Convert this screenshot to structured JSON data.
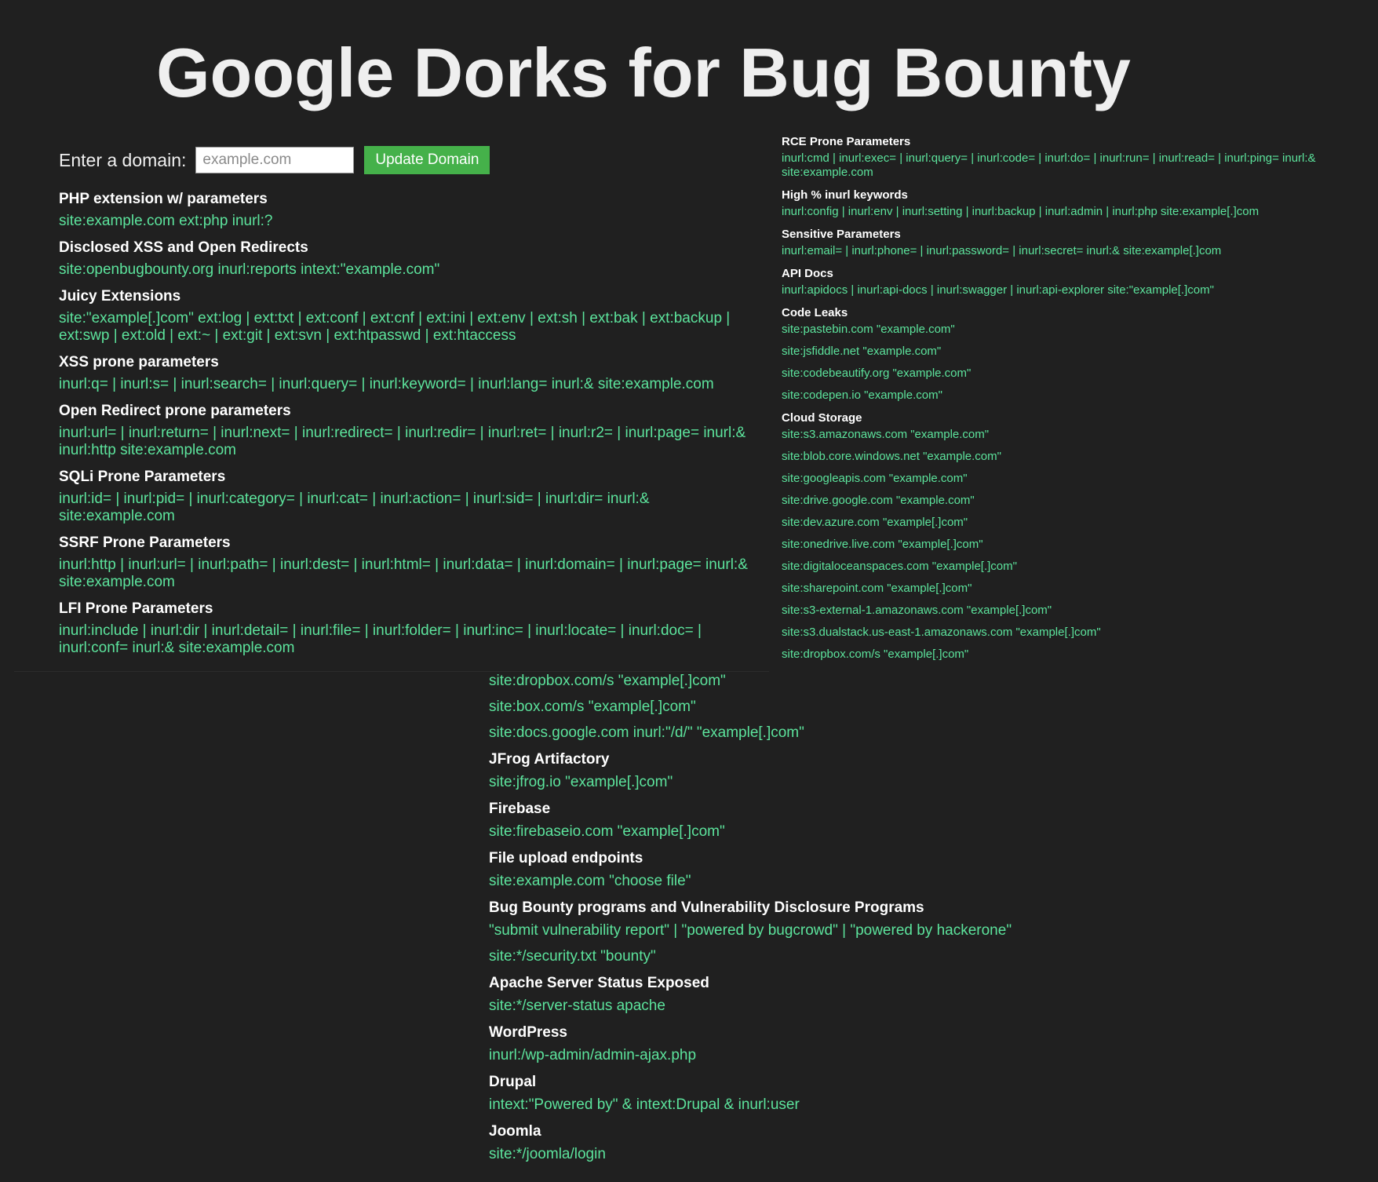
{
  "page": {
    "title": "Google Dorks for Bug Bounty"
  },
  "domain_form": {
    "label": "Enter a domain:",
    "placeholder": "example.com",
    "value": "",
    "button_label": "Update Domain",
    "button_color": "#45b14a"
  },
  "colors": {
    "background": "#202020",
    "link": "#5ce39c",
    "heading": "#ffffff"
  },
  "left_sections": [
    {
      "heading": "PHP extension w/ parameters",
      "links": [
        "site:example.com ext:php inurl:?"
      ]
    },
    {
      "heading": "Disclosed XSS and Open Redirects",
      "links": [
        "site:openbugbounty.org inurl:reports intext:\"example.com\""
      ]
    },
    {
      "heading": "Juicy Extensions",
      "links": [
        "site:\"example[.]com\" ext:log | ext:txt | ext:conf | ext:cnf | ext:ini | ext:env | ext:sh | ext:bak | ext:backup | ext:swp | ext:old | ext:~ | ext:git | ext:svn | ext:htpasswd | ext:htaccess"
      ]
    },
    {
      "heading": "XSS prone parameters",
      "links": [
        "inurl:q= | inurl:s= | inurl:search= | inurl:query= | inurl:keyword= | inurl:lang= inurl:& site:example.com"
      ]
    },
    {
      "heading": "Open Redirect prone parameters",
      "links": [
        "inurl:url= | inurl:return= | inurl:next= | inurl:redirect= | inurl:redir= | inurl:ret= | inurl:r2= | inurl:page= inurl:& inurl:http site:example.com"
      ]
    },
    {
      "heading": "SQLi Prone Parameters",
      "links": [
        "inurl:id= | inurl:pid= | inurl:category= | inurl:cat= | inurl:action= | inurl:sid= | inurl:dir= inurl:& site:example.com"
      ]
    },
    {
      "heading": "SSRF Prone Parameters",
      "links": [
        "inurl:http | inurl:url= | inurl:path= | inurl:dest= | inurl:html= | inurl:data= | inurl:domain= | inurl:page= inurl:& site:example.com"
      ]
    },
    {
      "heading": "LFI Prone Parameters",
      "links": [
        "inurl:include | inurl:dir | inurl:detail= | inurl:file= | inurl:folder= | inurl:inc= | inurl:locate= | inurl:doc= | inurl:conf= inurl:& site:example.com"
      ]
    }
  ],
  "right_sections": [
    {
      "heading": "RCE Prone Parameters",
      "links": [
        "inurl:cmd | inurl:exec= | inurl:query= | inurl:code= | inurl:do= | inurl:run= | inurl:read= | inurl:ping= inurl:& site:example.com"
      ]
    },
    {
      "heading": "High % inurl keywords",
      "links": [
        "inurl:config | inurl:env | inurl:setting | inurl:backup | inurl:admin | inurl:php site:example[.]com"
      ]
    },
    {
      "heading": "Sensitive Parameters",
      "links": [
        "inurl:email= | inurl:phone= | inurl:password= | inurl:secret= inurl:& site:example[.]com"
      ]
    },
    {
      "heading": "API Docs",
      "links": [
        "inurl:apidocs | inurl:api-docs | inurl:swagger | inurl:api-explorer site:\"example[.]com\""
      ]
    },
    {
      "heading": "Code Leaks",
      "links": [
        "site:pastebin.com \"example.com\"",
        "site:jsfiddle.net \"example.com\"",
        "site:codebeautify.org \"example.com\"",
        "site:codepen.io \"example.com\""
      ]
    },
    {
      "heading": "Cloud Storage",
      "links": [
        "site:s3.amazonaws.com \"example.com\"",
        "site:blob.core.windows.net \"example.com\"",
        "site:googleapis.com \"example.com\"",
        "site:drive.google.com \"example.com\"",
        "site:dev.azure.com \"example[.]com\"",
        "site:onedrive.live.com \"example[.]com\"",
        "site:digitaloceanspaces.com \"example[.]com\"",
        "site:sharepoint.com \"example[.]com\"",
        "site:s3-external-1.amazonaws.com \"example[.]com\"",
        "site:s3.dualstack.us-east-1.amazonaws.com \"example[.]com\"",
        "site:dropbox.com/s \"example[.]com\""
      ]
    }
  ],
  "bottom_sections": [
    {
      "heading": "",
      "links": [
        "site:dropbox.com/s \"example[.]com\"",
        "site:box.com/s \"example[.]com\"",
        "site:docs.google.com inurl:\"/d/\" \"example[.]com\""
      ]
    },
    {
      "heading": "JFrog Artifactory",
      "links": [
        "site:jfrog.io \"example[.]com\""
      ]
    },
    {
      "heading": "Firebase",
      "links": [
        "site:firebaseio.com \"example[.]com\""
      ]
    },
    {
      "heading": "File upload endpoints",
      "links": [
        "site:example.com \"choose file\""
      ]
    },
    {
      "heading": "Bug Bounty programs and Vulnerability Disclosure Programs",
      "links": [
        "\"submit vulnerability report\" | \"powered by bugcrowd\" | \"powered by hackerone\"",
        "site:*/security.txt \"bounty\""
      ]
    },
    {
      "heading": "Apache Server Status Exposed",
      "links": [
        "site:*/server-status apache"
      ]
    },
    {
      "heading": "WordPress",
      "links": [
        "inurl:/wp-admin/admin-ajax.php"
      ]
    },
    {
      "heading": "Drupal",
      "links": [
        "intext:\"Powered by\" & intext:Drupal & inurl:user"
      ]
    },
    {
      "heading": "Joomla",
      "links": [
        "site:*/joomla/login"
      ]
    }
  ]
}
